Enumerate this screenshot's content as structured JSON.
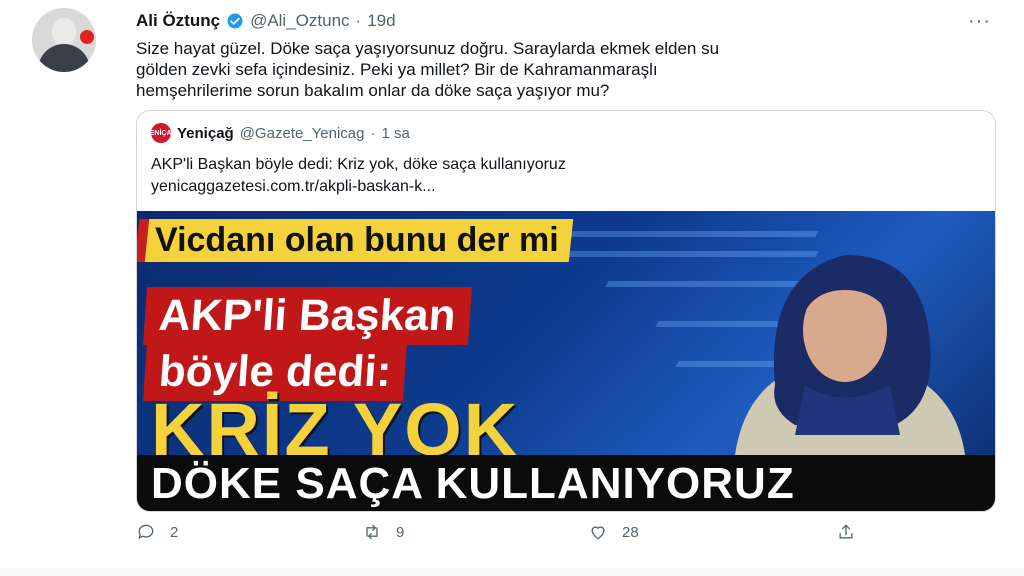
{
  "tweet": {
    "name": "Ali Öztunç",
    "handle": "@Ali_Oztunc",
    "separator": "·",
    "time": "19d",
    "more": "···",
    "text": "Size hayat güzel. Döke saça yaşıyorsunuz doğru. Saraylarda ekmek elden su\ngölden zevki sefa içindesiniz. Peki ya millet? Bir de Kahramanmaraşlı\nhemşehrilerime sorun bakalım onlar da döke saça yaşıyor mu?"
  },
  "quote": {
    "logo": "YENİÇAĞ",
    "name": "Yeniçağ",
    "handle": "@Gazete_Yenicag",
    "separator": "·",
    "time": "1 sa",
    "text": "AKP'li Başkan böyle dedi: Kriz yok, döke saça kullanıyoruz",
    "url": "yenicaggazetesi.com.tr/akpli-baskan-k..."
  },
  "media": {
    "line1": "Vicdanı olan bunu der mi",
    "line2": "AKP'li Başkan",
    "line3": "böyle dedi:",
    "line4": "KRİZ YOK",
    "line5": "DÖKE SAÇA KULLANIYORUZ"
  },
  "actions": {
    "replies": "2",
    "retweets": "9",
    "likes": "28"
  },
  "colors": {
    "text": "#0f1419",
    "secondary": "#536471",
    "verified": "#1d9bf0",
    "banner_yellow": "#f4d23c",
    "banner_red": "#c01818"
  }
}
